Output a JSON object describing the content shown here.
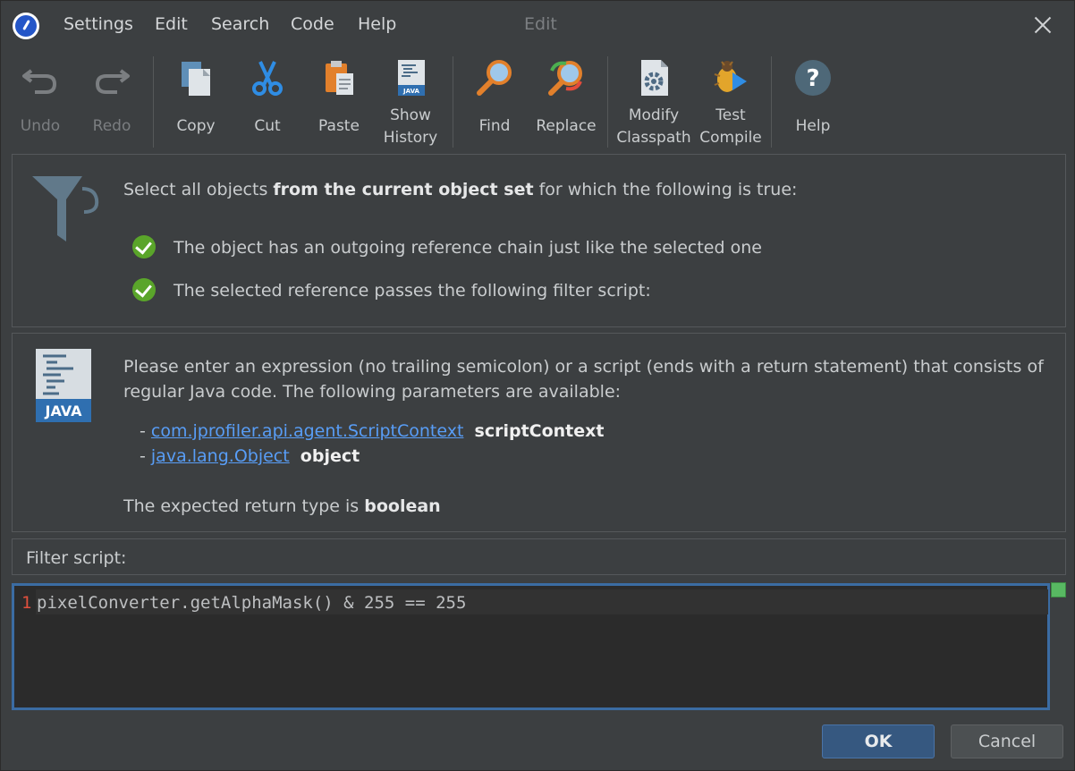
{
  "window": {
    "title": "Edit",
    "menu": [
      "Settings",
      "Edit",
      "Search",
      "Code",
      "Help"
    ]
  },
  "toolbar": {
    "undo": "Undo",
    "redo": "Redo",
    "copy": "Copy",
    "cut": "Cut",
    "paste": "Paste",
    "show_history_1": "Show",
    "show_history_2": "History",
    "find": "Find",
    "replace": "Replace",
    "modify_classpath_1": "Modify",
    "modify_classpath_2": "Classpath",
    "test_compile_1": "Test",
    "test_compile_2": "Compile",
    "help": "Help"
  },
  "filter_panel": {
    "intro_1": "Select all objects ",
    "intro_bold": "from the current object set",
    "intro_2": " for which the following is true:",
    "conditions": [
      "The object has an outgoing reference chain just like the selected one",
      "The selected reference passes the following filter script:"
    ]
  },
  "java_panel": {
    "icon_label": "JAVA",
    "description_1": "Please enter an expression (no trailing semicolon) or a script (ends with a return statement) that consists of",
    "description_2": "regular Java code. The following parameters are available:",
    "params": [
      {
        "dash": "- ",
        "type": "com.jprofiler.api.agent.ScriptContext",
        "name": "scriptContext"
      },
      {
        "dash": "- ",
        "type": "java.lang.Object",
        "name": "object"
      }
    ],
    "return_text": "The expected return type is ",
    "return_type": "boolean"
  },
  "script": {
    "label": "Filter script:",
    "line_number": "1",
    "code": "pixelConverter.getAlphaMask() & 255 == 255"
  },
  "buttons": {
    "ok": "OK",
    "cancel": "Cancel"
  }
}
